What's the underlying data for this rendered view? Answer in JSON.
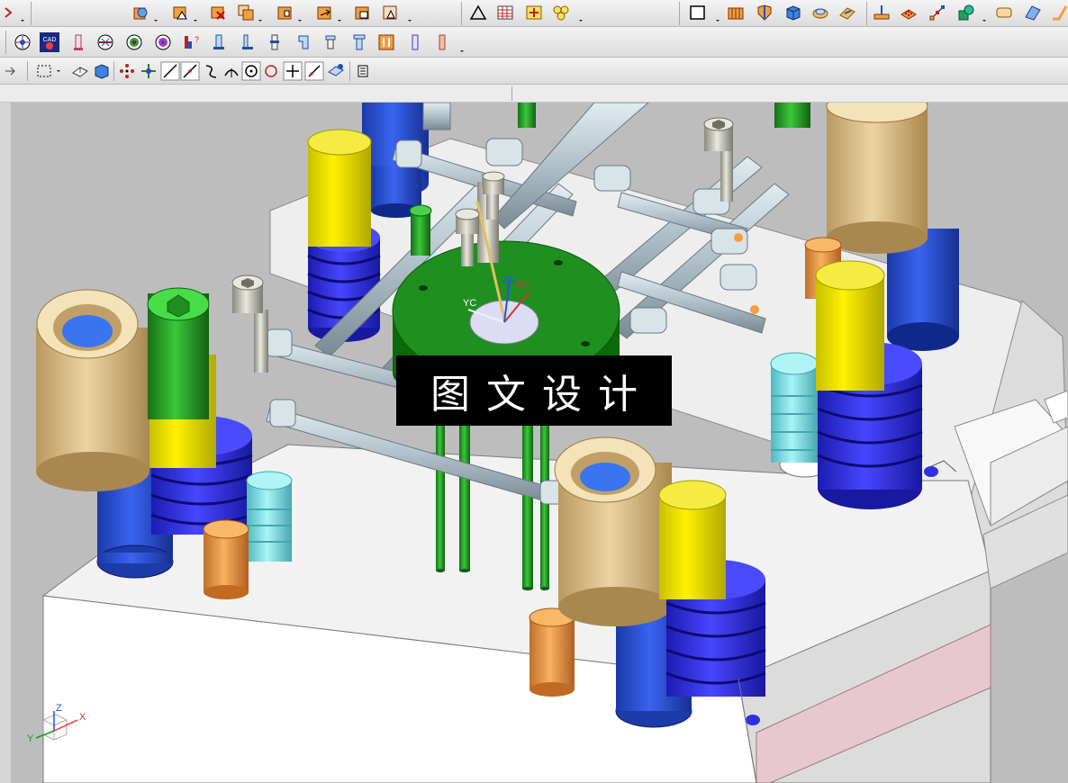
{
  "watermark": {
    "text": "图文设计"
  },
  "wcs": {
    "xc_label": "XC",
    "yc_label": "YC",
    "zc_label": "ZC"
  },
  "triad": {
    "x_label": "X",
    "y_label": "Y",
    "z_label": "Z"
  },
  "toolbar_row2": {
    "cad_button_label": "CAD"
  },
  "colors": {
    "toolbar_bg": "#e4e4e4",
    "viewport_bg": "#bdbdbd",
    "plate_top": "#f2f2f2",
    "plate_side": "#ffffff",
    "pink_plate": "#e8c8cf",
    "bushing_tan": "#dcc28e",
    "guide_blue": "#2c52d8",
    "spring_blue": "#3a3aee",
    "yellow_pin": "#f0e600",
    "green": "#1f8f1f",
    "cyan_stop": "#8ae6ea",
    "orange_pin": "#f0a04a",
    "pipe_grey": "#b9c7cd"
  },
  "icons": {
    "row1": [
      "view-section-icon",
      "assembly-icon",
      "wave-link-icon",
      "replace-component-icon",
      "mate-component-icon",
      "reposition-icon",
      "explode-icon",
      "clone-icon",
      "triangle-icon",
      "table-icon",
      "add-point-icon",
      "group-icon",
      "rectangle-icon",
      "orange-bars-icon",
      "shield-icon",
      "cube-icon",
      "pad-icon",
      "edit-face-icon",
      "datum-icon",
      "grid-points-icon",
      "sketch-nodes-icon",
      "shape-icon",
      "surface-icon",
      "sheen-icon",
      "corner-icon"
    ],
    "row2": [
      "mold-wizard-icon",
      "cad-icon",
      "ejector-pin-icon",
      "cooling-icon",
      "gate-icon",
      "runner-icon",
      "electrode-icon",
      "standard-part-icon",
      "slider-icon",
      "lifter-icon",
      "sprue-icon",
      "insert-icon",
      "pocket-icon",
      "bom-icon",
      "drawing-icon",
      "orange-part-icon",
      "pin-icon",
      "tube-icon"
    ],
    "row3": [
      "arrow-icon",
      "select-box-icon",
      "fit-icon",
      "view-cube-icon",
      "snap-points-icon",
      "move-icon",
      "line-icon",
      "arc-icon",
      "curve-icon",
      "ortho-icon",
      "circle-point-icon",
      "circle-icon",
      "cross-icon",
      "slash-icon",
      "measure-icon",
      "sheet-icon"
    ]
  }
}
